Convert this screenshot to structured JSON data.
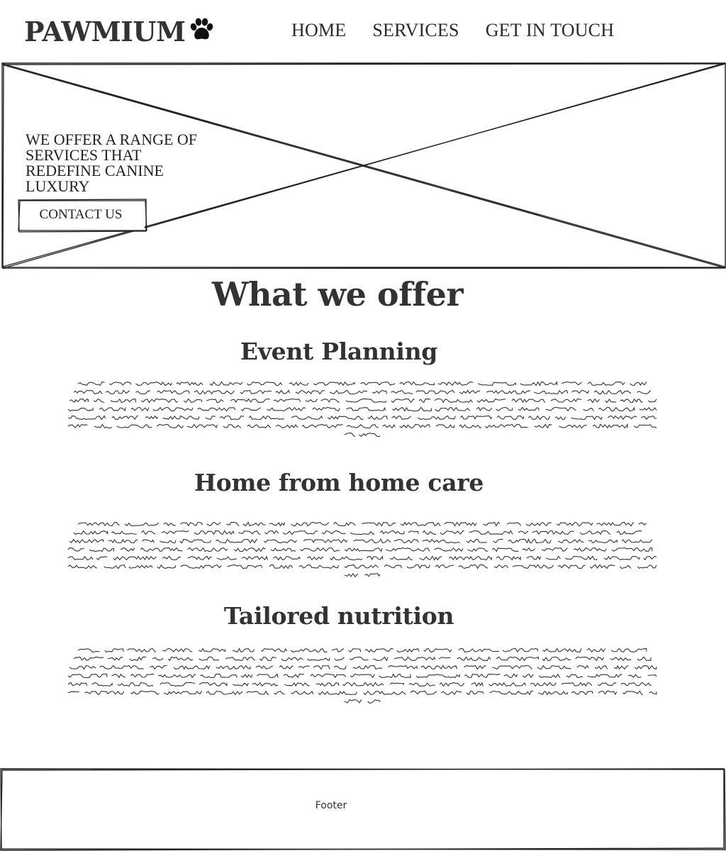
{
  "header": {
    "brand": "PAWMIUM",
    "brand_icon": "paw-icon",
    "nav": [
      {
        "label": "HOME"
      },
      {
        "label": "SERVICES"
      },
      {
        "label": "GET IN TOUCH"
      }
    ]
  },
  "hero": {
    "image_placeholder": "image-placeholder-icon",
    "headline": "WE OFFER A RANGE OF SERVICES THAT REDEFINE CANINE LUXURY",
    "cta_label": "CONTACT US"
  },
  "main": {
    "title": "What we offer",
    "services": [
      {
        "title": "Event Planning"
      },
      {
        "title": "Home from home care"
      },
      {
        "title": "Tailored nutrition"
      }
    ]
  },
  "footer": {
    "label": "Footer"
  }
}
